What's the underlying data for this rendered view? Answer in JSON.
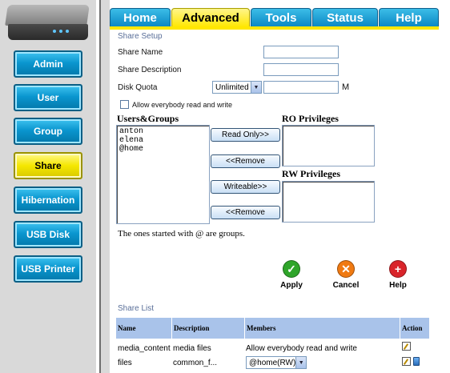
{
  "nav": {
    "items": [
      {
        "label": "Admin"
      },
      {
        "label": "User"
      },
      {
        "label": "Group"
      },
      {
        "label": "Share"
      },
      {
        "label": "Hibernation"
      },
      {
        "label": "USB Disk"
      },
      {
        "label": "USB Printer"
      }
    ],
    "active": "Share"
  },
  "tabs": [
    {
      "label": "Home"
    },
    {
      "label": "Advanced"
    },
    {
      "label": "Tools"
    },
    {
      "label": "Status"
    },
    {
      "label": "Help"
    }
  ],
  "active_tab": "Advanced",
  "setup": {
    "title": "Share Setup",
    "share_name_label": "Share Name",
    "share_name_value": "",
    "share_desc_label": "Share Description",
    "share_desc_value": "",
    "disk_quota_label": "Disk Quota",
    "disk_quota_select": "Unlimited",
    "disk_quota_value": "",
    "disk_quota_unit": "M",
    "allow_everybody_label": "Allow everybody read and write",
    "allow_everybody_checked": false
  },
  "privileges": {
    "users_groups_title": "Users&Groups",
    "users_groups": [
      "anton",
      "elena",
      "@home"
    ],
    "read_only_button": "Read Only>>",
    "remove_button": "<<Remove",
    "writeable_button": "Writeable>>",
    "ro_title": "RO Privileges",
    "rw_title": "RW Privileges",
    "note": "The ones started with @ are groups."
  },
  "actions": {
    "apply": "Apply",
    "cancel": "Cancel",
    "help": "Help"
  },
  "share_list": {
    "title": "Share List",
    "headers": [
      "Name",
      "Description",
      "Members",
      "Action"
    ],
    "rows": [
      {
        "name": "media_content",
        "description": "media files",
        "members": "Allow everybody read and write"
      },
      {
        "name": "files",
        "description": "common_f...",
        "members": "@home(RW)"
      }
    ]
  },
  "colors": {
    "nav_blue": "#0a96cf",
    "active_yellow": "#f5e700",
    "table_header": "#a9c3ea",
    "apply_green": "#2fa52a",
    "cancel_orange": "#f07a12",
    "help_red": "#d9242a"
  }
}
